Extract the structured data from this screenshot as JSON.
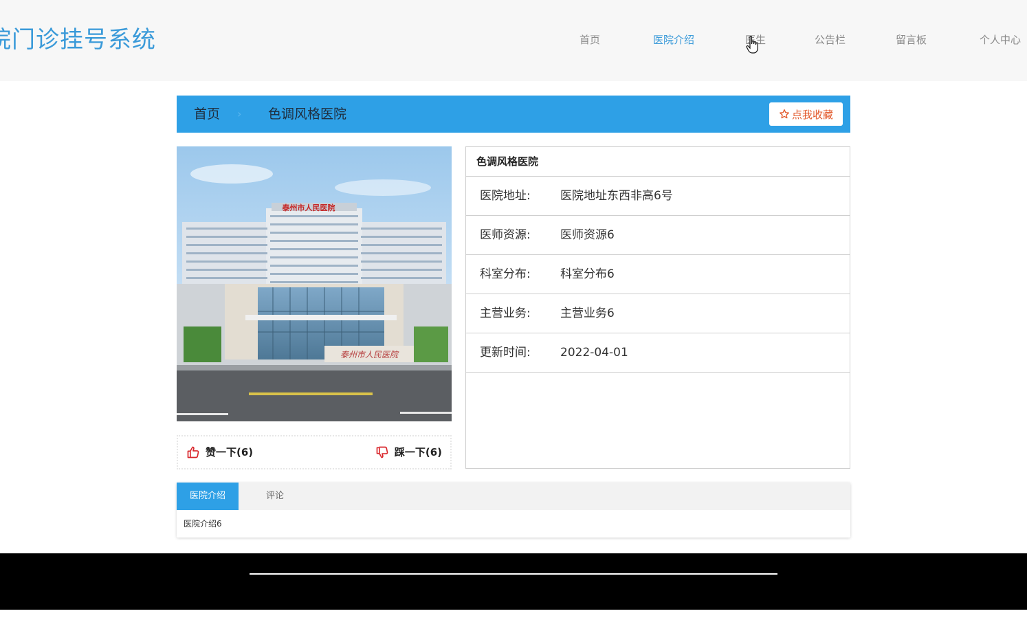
{
  "header": {
    "site_title": "院门诊挂号系统",
    "nav": [
      {
        "label": "首页",
        "active": false
      },
      {
        "label": "医院介绍",
        "active": true
      },
      {
        "label": "医生",
        "active": false
      },
      {
        "label": "公告栏",
        "active": false
      },
      {
        "label": "留言板",
        "active": false
      },
      {
        "label": "个人中心",
        "active": false
      }
    ]
  },
  "breadcrumb": {
    "home": "首页",
    "separator": "›",
    "current": "色调风格医院",
    "favorite_label": "点我收藏"
  },
  "photo": {
    "building_sign": "泰州市人民医院",
    "stone_sign": "泰州市人民医院"
  },
  "votes": {
    "like_label": "赞一下(6)",
    "dislike_label": "踩一下(6)"
  },
  "info": {
    "title": "色调风格医院",
    "rows": [
      {
        "label": "医院地址:",
        "value": "医院地址东西非高6号"
      },
      {
        "label": "医师资源:",
        "value": "医师资源6"
      },
      {
        "label": "科室分布:",
        "value": "科室分布6"
      },
      {
        "label": "主营业务:",
        "value": "主营业务6"
      },
      {
        "label": "更新时间:",
        "value": "2022-04-01"
      }
    ]
  },
  "tabs": {
    "items": [
      {
        "label": "医院介绍",
        "active": true
      },
      {
        "label": "评论",
        "active": false
      }
    ],
    "content": "医院介绍6"
  },
  "colors": {
    "accent": "#2ea0e6",
    "title": "#3a9ad9",
    "favorite": "#e2592b",
    "vote_icon": "#d9262b"
  }
}
